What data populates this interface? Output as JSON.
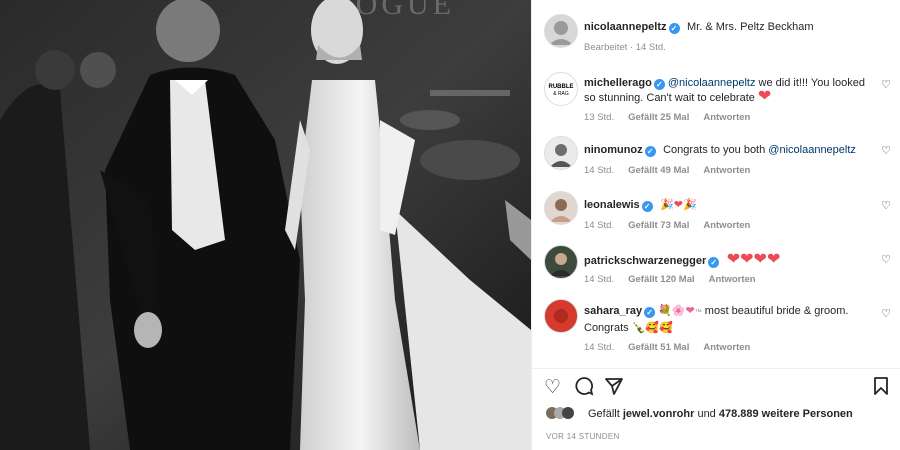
{
  "post": {
    "author": "nicolaanneppeltz",
    "author_display": "nicolaannepeltz",
    "caption": "Mr. & Mrs. Peltz Beckham",
    "edited": "Bearbeitet · 14 Std.",
    "photo_banner": "VOGUE"
  },
  "comments": [
    {
      "user": "michellerago",
      "mention": "@nicolaannepeltz",
      "text": " we did it!!! You looked so stunning. Can't wait to celebrate ",
      "time": "13 Std.",
      "likes": "Gefällt 25 Mal",
      "reply": "Antworten",
      "emoji": "heart"
    },
    {
      "user": "ninomunoz",
      "text": "Congrats to you both ",
      "mention": "@nicolaannepeltz",
      "time": "14 Std.",
      "likes": "Gefällt 49 Mal",
      "reply": "Antworten"
    },
    {
      "user": "leonalewis",
      "time": "14 Std.",
      "likes": "Gefällt 73 Mal",
      "reply": "Antworten",
      "emoji": "party-heart-party"
    },
    {
      "user": "patrickschwarzenegger",
      "time": "14 Std.",
      "likes": "Gefällt 120 Mal",
      "reply": "Antworten",
      "emoji": "hearts-4"
    },
    {
      "user": "sahara_ray",
      "text": " most beautiful bride & groom.",
      "text2": "Congrats ",
      "time": "14 Std.",
      "likes": "Gefällt 51 Mal",
      "reply": "Antworten",
      "emoji": "bouquet-flower-heart-tm"
    }
  ],
  "likes_line": {
    "prefix": "Gefällt ",
    "user": "jewel.vonrohr",
    "mid": " und ",
    "count": "478.889 weitere Personen"
  },
  "timestamp": "VOR 14 STUNDEN",
  "icons": {
    "like": "heart-outline-icon",
    "comment": "comment-icon",
    "share": "paper-plane-icon",
    "save": "bookmark-icon"
  },
  "colors": {
    "verified": "#3897f0",
    "heart": "#ed4956",
    "mention": "#00376b",
    "muted": "#8e8e8e"
  }
}
